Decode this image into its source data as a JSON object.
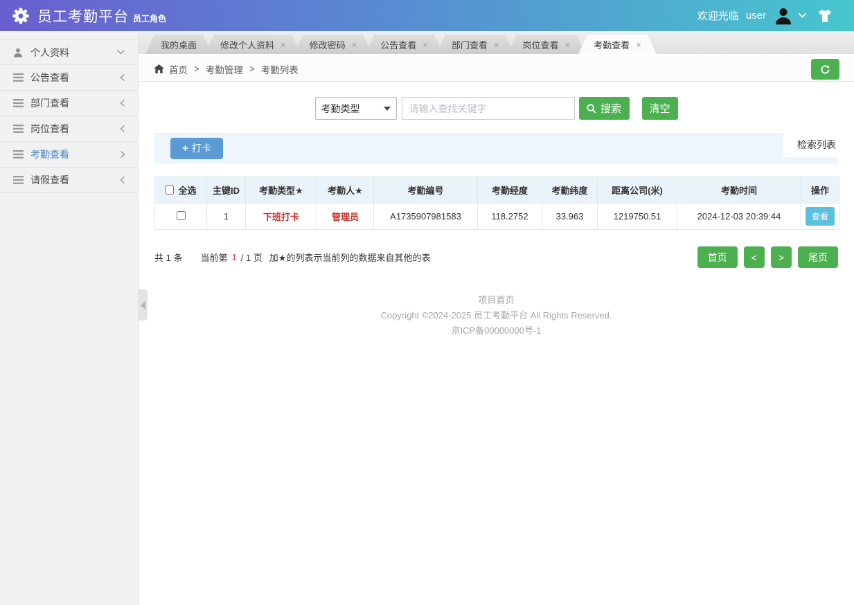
{
  "icons": {
    "close": "×",
    "plus": "+"
  },
  "colors": {
    "header_gradient_left": "#6a5ecf",
    "header_gradient_right": "#47c6ce",
    "accent_green": "#4cb050",
    "primary_blue": "#5b9bd5",
    "info_blue": "#5bc0de",
    "danger_red": "#c9302c",
    "active_menu_blue": "#4a86c8"
  },
  "header": {
    "title": "员工考勤平台",
    "subtitle": "员工角色",
    "welcome": "欢迎光临",
    "username": "user"
  },
  "sidebar": {
    "items": [
      {
        "label": "个人资料",
        "icon": "user-icon",
        "chevron": "down",
        "active": false
      },
      {
        "label": "公告查看",
        "icon": "menu-icon",
        "chevron": "left",
        "active": false
      },
      {
        "label": "部门查看",
        "icon": "menu-icon",
        "chevron": "left",
        "active": false
      },
      {
        "label": "岗位查看",
        "icon": "menu-icon",
        "chevron": "left",
        "active": false
      },
      {
        "label": "考勤查看",
        "icon": "menu-icon",
        "chevron": "right",
        "active": true
      },
      {
        "label": "请假查看",
        "icon": "menu-icon",
        "chevron": "left",
        "active": false
      }
    ]
  },
  "tabs": [
    {
      "label": "我的桌面",
      "closable": false,
      "active": false
    },
    {
      "label": "修改个人资料",
      "closable": true,
      "active": false
    },
    {
      "label": "修改密码",
      "closable": true,
      "active": false
    },
    {
      "label": "公告查看",
      "closable": true,
      "active": false
    },
    {
      "label": "部门查看",
      "closable": true,
      "active": false
    },
    {
      "label": "岗位查看",
      "closable": true,
      "active": false
    },
    {
      "label": "考勤查看",
      "closable": true,
      "active": true
    }
  ],
  "breadcrumb": {
    "home": "首页",
    "section": "考勤管理",
    "page": "考勤列表",
    "separator": ">"
  },
  "search": {
    "type_select": "考勤类型",
    "placeholder": "请输入查找关键字",
    "search_label": "搜索",
    "clear_label": "清空"
  },
  "toolbar": {
    "punch_label": "打卡",
    "panel_label": "检索列表"
  },
  "table": {
    "columns": [
      "全选",
      "主键ID",
      "考勤类型★",
      "考勤人★",
      "考勤编号",
      "考勤经度",
      "考勤纬度",
      "距离公司(米)",
      "考勤时间",
      "操作"
    ],
    "row": {
      "id": "1",
      "type": "下班打卡",
      "person": "管理员",
      "code": "A1735907981583",
      "longitude": "118.2752",
      "latitude": "33.963",
      "distance": "1219750.51",
      "time": "2024-12-03 20:39:44",
      "action": "查看"
    }
  },
  "pagination": {
    "total": "共 1 条",
    "current_prefix": "当前第",
    "current_page": "1",
    "current_suffix": "/ 1 页",
    "note": "加★的列表示当前列的数据来自其他的表",
    "first": "首页",
    "prev": "<",
    "next": ">",
    "last": "尾页"
  },
  "footer": {
    "home": "项目首页",
    "copyright": "Copyright ©2024-2025 员工考勤平台 All Rights Reserved.",
    "icp": "京ICP备00000000号-1"
  }
}
